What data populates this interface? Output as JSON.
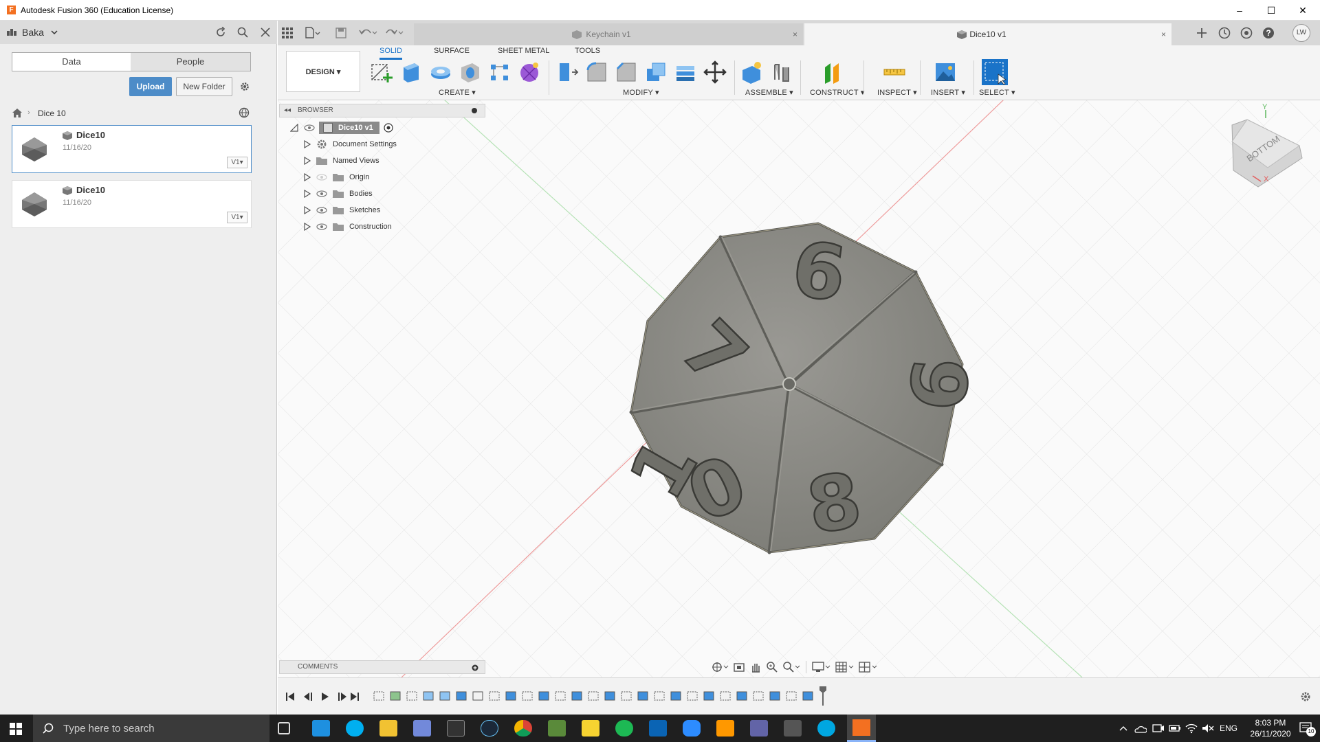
{
  "window": {
    "title": "Autodesk Fusion 360 (Education License)",
    "app_icon_letter": "F",
    "minimize": "–",
    "maximize": "☐",
    "close": "✕"
  },
  "data_panel": {
    "user": "Baka",
    "tabs": [
      "Data",
      "People"
    ],
    "upload_label": "Upload",
    "new_folder_label": "New Folder",
    "breadcrumb": "Dice 10",
    "files": [
      {
        "name": "Dice10",
        "date": "11/16/20",
        "version": "V1▾"
      },
      {
        "name": "Dice10",
        "date": "11/16/20",
        "version": "V1▾"
      }
    ]
  },
  "doc_tabs": [
    {
      "label": "Keychain v1",
      "active": false
    },
    {
      "label": "Dice10 v1",
      "active": true
    }
  ],
  "tab_close": "×",
  "user_initials": "LW",
  "ribbon": {
    "workspace": "DESIGN ▾",
    "tabs": [
      "SOLID",
      "SURFACE",
      "SHEET METAL",
      "TOOLS"
    ],
    "groups": [
      "CREATE ▾",
      "MODIFY ▾",
      "ASSEMBLE ▾",
      "CONSTRUCT ▾",
      "INSPECT ▾",
      "INSERT ▾",
      "SELECT ▾"
    ]
  },
  "browser": {
    "header": "BROWSER",
    "root": "Dice10 v1",
    "items": [
      "Document Settings",
      "Named Views",
      "Origin",
      "Bodies",
      "Sketches",
      "Construction"
    ]
  },
  "comments_label": "COMMENTS",
  "viewcube_label": "BOTTOM",
  "axis_labels": {
    "x": "X",
    "y": "Y"
  },
  "dice_numbers": [
    "6",
    "7",
    "9",
    "1",
    "0",
    "8"
  ],
  "taskbar": {
    "search_placeholder": "Type here to search",
    "language": "ENG",
    "time": "8:03 PM",
    "date": "26/11/2020",
    "notification_count": "10"
  },
  "colors": {
    "accent": "#1a73c8",
    "upload_button": "#4d8cc8",
    "dice_face": "#8a8a85",
    "fusion_orange": "#f37021",
    "taskbar": "#1f1f1f"
  }
}
